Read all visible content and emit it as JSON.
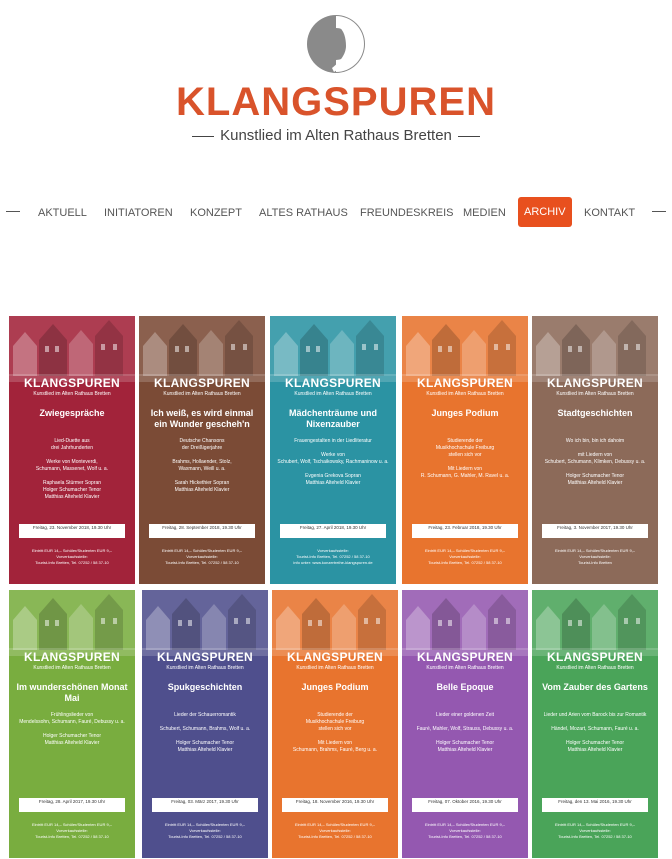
{
  "header": {
    "brand": "KLANGSPUREN",
    "tagline": "Kunstlied im Alten Rathaus Bretten",
    "colors": {
      "brand_orange": "#d9532b",
      "logo_gray": "#8a8a8a"
    }
  },
  "nav": {
    "items": [
      {
        "label": "Aktuell"
      },
      {
        "label": "Initiatoren"
      },
      {
        "label": "Konzept"
      },
      {
        "label": "Altes Rathaus"
      },
      {
        "label": "Freundeskreis"
      },
      {
        "label": "Medien"
      },
      {
        "label": "Archiv",
        "active": true
      },
      {
        "label": "Kontakt"
      }
    ],
    "active_color": "#e8501e"
  },
  "posters": [
    {
      "bg": "#a2233a",
      "brand": "KLANGSPUREN",
      "brand_sub": "Kunstlied im Alten Rathaus Bretten",
      "title": "Zwiegespräche",
      "body": "Lied-Duette aus\ndrei Jahrhunderten\n\nWerke von Monteverdi,\nSchumann, Massenet, Wolf u. a.\n\nRaphaela Stürmer Sopran\nHolger Schumacher Tenor\nMatthias Alteheld Klavier",
      "date": "Freitag, 23. November 2018, 19.30 Uhr",
      "foot": "Eintritt EUR 14,– Schüler/Studenten EUR 9,–\nVorverkaufsstelle:\nTourist-Info Bretten, Tel. 07252 / 58 37-10"
    },
    {
      "bg": "#7b4b36",
      "brand": "KLANGSPUREN",
      "brand_sub": "Kunstlied im Alten Rathaus Bretten",
      "title": "Ich weiß, es wird einmal ein Wunder gescheh'n",
      "body": "Deutsche Chansons\nder Dreißigerjahre\n\nBrahms, Hollaender, Stolz,\nWaxmann, Weill u. a.\n\nSarah Hickethier Sopran\nMatthias Alteheld Klavier",
      "date": "Freitag, 28. September 2018, 19.30 Uhr",
      "foot": "Eintritt EUR 14,– Schüler/Studenten EUR 9,–\nVorverkaufsstelle:\nTourist-Info Bretten, Tel. 07252 / 58 37-10"
    },
    {
      "bg": "#2b93a3",
      "brand": "KLANGSPUREN",
      "brand_sub": "Kunstlied im Alten Rathaus Bretten",
      "title": "Mädchenträume und Nixenzauber",
      "body": "Frauengestalten in der Liedliteratur\n\nWerke von\nSchubert, Wolf, Tschaikowsky, Rachmaninow u. a.\n\nEvgenia Grekova Sopran\nMatthias Alteheld Klavier",
      "date": "Freitag, 27. April 2018, 19.30 Uhr",
      "foot": "Vorverkaufsstelle:\nTourist-Info Bretten, Tel. 07252 / 58 37-10\ninfo unter: www.konzertreihe-klangspuren.de"
    },
    {
      "bg": "#e8742e",
      "brand": "KLANGSPUREN",
      "brand_sub": "Kunstlied im Alten Rathaus Bretten",
      "title": "Junges Podium",
      "body": "Studierende der\nMusikhochschule Freiburg\nstellen sich vor\n\nMit Liedern von\nR. Schumann, G. Mahler, M. Ravel u. a.",
      "date": "Freitag, 23. Februar 2018, 19.30 Uhr",
      "foot": "Eintritt EUR 14,– Schüler/Studenten EUR 9,–\nVorverkaufsstelle:\nTourist-Info Bretten, Tel. 07252 / 58 37-10"
    },
    {
      "bg": "#8c6a59",
      "brand": "KLANGSPUREN",
      "brand_sub": "Kunstlied im Alten Rathaus Bretten",
      "title": "Stadtgeschichten",
      "body": "Wo ich bin, bin ich dahoim\n\nmit Liedern von\nSchubert, Schumann, Klimken, Debussy u. a.\n\nHolger Schumacher Tenor\nMatthias Alteheld Klavier",
      "date": "Freitag, 3. November 2017, 19.30 Uhr",
      "foot": "Eintritt EUR 14,– Schüler/Studenten EUR 9,–\nVorverkaufsstelle:\nTourist-Info Bretten"
    },
    {
      "bg": "#79ad3f",
      "brand": "KLANGSPUREN",
      "brand_sub": "Kunstlied im Alten Rathaus Bretten",
      "title": "Im wunderschönen Monat Mai",
      "body": "Frühlingslieder von\nMendelssohn, Schumann, Fauré, Debussy u. a.\n\nHolger Schumacher Tenor\nMatthias Alteheld Klavier",
      "date": "Freitag, 28. April 2017, 19.30 Uhr",
      "foot": "Eintritt EUR 14,– Schüler/Studenten EUR 9,–\nVorverkaufsstelle:\nTourist-Info Bretten, Tel. 07252 / 58 37-10"
    },
    {
      "bg": "#4f4f8d",
      "brand": "KLANGSPUREN",
      "brand_sub": "Kunstlied im Alten Rathaus Bretten",
      "title": "Spukgeschichten",
      "body": "Lieder der Schauerromantik\n\nSchubert, Schumann, Brahms, Wolf u. a.\n\nHolger Schumacher Tenor\nMatthias Alteheld Klavier",
      "date": "Freitag, 03. März 2017, 19.30 Uhr",
      "foot": "Eintritt EUR 14,– Schüler/Studenten EUR 9,–\nVorverkaufsstelle:\nTourist-Info Bretten, Tel. 07252 / 58 37-10"
    },
    {
      "bg": "#e8742e",
      "brand": "KLANGSPUREN",
      "brand_sub": "Kunstlied im Alten Rathaus Bretten",
      "title": "Junges Podium",
      "body": "Studierende der\nMusikhochschule Freiburg\nstellen sich vor\n\nMit Liedern von\nSchumann, Brahms, Fauré, Berg u. a.",
      "date": "Freitag, 18. November 2016, 19.30 Uhr",
      "foot": "Eintritt EUR 14,– Schüler/Studenten EUR 9,–\nVorverkaufsstelle:\nTourist-Info Bretten, Tel. 07252 / 58 37-10"
    },
    {
      "bg": "#9458b0",
      "brand": "KLANGSPUREN",
      "brand_sub": "Kunstlied im Alten Rathaus Bretten",
      "title": "Belle Epoque",
      "body": "Lieder einer goldenen Zeit\n\nFauré, Mahler, Wolf, Strauss, Debussy u. a.\n\nHolger Schumacher Tenor\nMatthias Alteheld Klavier",
      "date": "Freitag, 07. Oktober 2016, 19.30 Uhr",
      "foot": "Eintritt EUR 14,– Schüler/Studenten EUR 9,–\nVorverkaufsstelle:\nTourist-Info Bretten, Tel. 07252 / 58 37-10"
    },
    {
      "bg": "#4aa459",
      "brand": "KLANGSPUREN",
      "brand_sub": "Kunstlied im Alten Rathaus Bretten",
      "title": "Vom Zauber des Gartens",
      "body": "Lieder und Arien vom Barock bis zur Romantik\n\nHändel, Mozart, Schumann, Fauré u. a.\n\nHolger Schumacher Tenor\nMatthias Alteheld Klavier",
      "date": "Freitag, den 13. Mai 2016, 19.30 Uhr",
      "foot": "Eintritt EUR 14,– Schüler/Studenten EUR 9,–\nVorverkaufsstelle:\nTourist-Info Bretten, Tel. 07252 / 58 37-10"
    }
  ]
}
